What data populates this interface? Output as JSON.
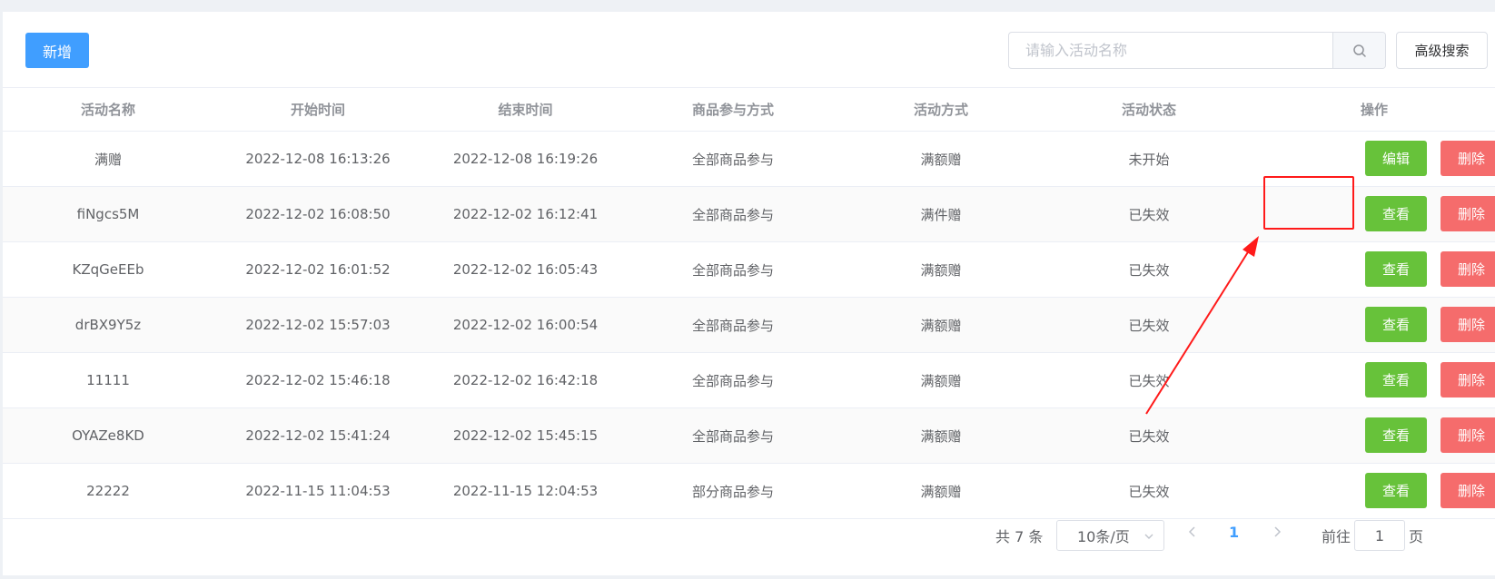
{
  "toolbar": {
    "add_label": "新增",
    "search_placeholder": "请输入活动名称",
    "advanced_search_label": "高级搜索"
  },
  "table": {
    "columns": [
      "活动名称",
      "开始时间",
      "结束时间",
      "商品参与方式",
      "活动方式",
      "活动状态",
      "操作"
    ],
    "rows": [
      {
        "name": "满赠",
        "start": "2022-12-08 16:13:26",
        "end": "2022-12-08 16:19:26",
        "scope": "全部商品参与",
        "mode": "满额赠",
        "status": "未开始",
        "primary_action": "编辑",
        "delete_action": "删除"
      },
      {
        "name": "fiNgcs5M",
        "start": "2022-12-02 16:08:50",
        "end": "2022-12-02 16:12:41",
        "scope": "全部商品参与",
        "mode": "满件赠",
        "status": "已失效",
        "primary_action": "查看",
        "delete_action": "删除"
      },
      {
        "name": "KZqGeEEb",
        "start": "2022-12-02 16:01:52",
        "end": "2022-12-02 16:05:43",
        "scope": "全部商品参与",
        "mode": "满额赠",
        "status": "已失效",
        "primary_action": "查看",
        "delete_action": "删除"
      },
      {
        "name": "drBX9Y5z",
        "start": "2022-12-02 15:57:03",
        "end": "2022-12-02 16:00:54",
        "scope": "全部商品参与",
        "mode": "满额赠",
        "status": "已失效",
        "primary_action": "查看",
        "delete_action": "删除"
      },
      {
        "name": "11111",
        "start": "2022-12-02 15:46:18",
        "end": "2022-12-02 16:42:18",
        "scope": "全部商品参与",
        "mode": "满额赠",
        "status": "已失效",
        "primary_action": "查看",
        "delete_action": "删除"
      },
      {
        "name": "OYAZe8KD",
        "start": "2022-12-02 15:41:24",
        "end": "2022-12-02 15:45:15",
        "scope": "全部商品参与",
        "mode": "满额赠",
        "status": "已失效",
        "primary_action": "查看",
        "delete_action": "删除"
      },
      {
        "name": "22222",
        "start": "2022-11-15 11:04:53",
        "end": "2022-11-15 12:04:53",
        "scope": "部分商品参与",
        "mode": "满额赠",
        "status": "已失效",
        "primary_action": "查看",
        "delete_action": "删除"
      }
    ]
  },
  "pagination": {
    "total_label": "共 7 条",
    "page_size": "10条/页",
    "current_page": "1",
    "goto_prefix": "前往",
    "goto_value": "1",
    "goto_suffix": "页"
  },
  "colors": {
    "primary": "#409eff",
    "success": "#67c23a",
    "danger": "#f56c6c",
    "annotation": "#ff1a1a"
  },
  "icons": {
    "search": "search-icon",
    "dropdown": "chevron-down-icon",
    "prev": "chevron-left-icon",
    "next": "chevron-right-icon"
  }
}
